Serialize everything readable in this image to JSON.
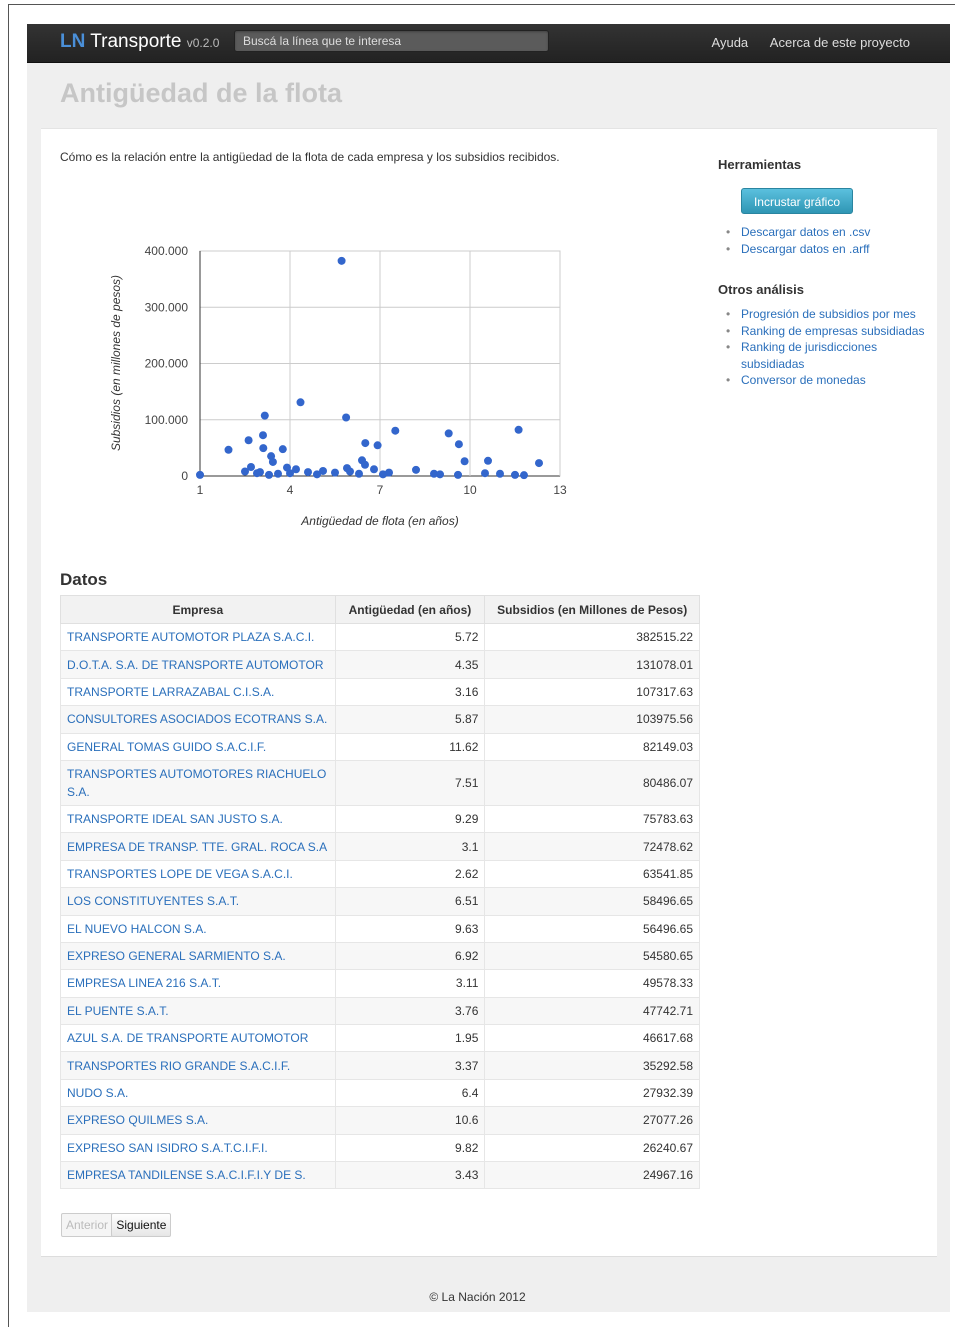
{
  "navbar": {
    "brand_ln": "LN",
    "brand_name": "Transporte",
    "version": "v0.2.0",
    "search_placeholder": "Buscá la línea que te interesa",
    "links": [
      "Ayuda",
      "Acerca de este proyecto"
    ]
  },
  "page": {
    "title": "Antigüedad de la flota",
    "intro": "Cómo es la relación entre la antigüedad de la flota de cada empresa y los subsidios recibidos."
  },
  "sidebar": {
    "tools_title": "Herramientas",
    "embed_button": "Incrustar gráfico",
    "downloads": [
      "Descargar datos en .csv",
      "Descargar datos en .arff"
    ],
    "other_title": "Otros análisis",
    "other_links": [
      "Progresión de subsidios por mes",
      "Ranking de empresas subsidiadas",
      "Ranking de jurisdicciones subsidiadas",
      "Conversor de monedas"
    ]
  },
  "chart_data": {
    "type": "scatter",
    "xlabel": "Antigüedad de flota (en años)",
    "ylabel": "Subsidios (en millones de pesos)",
    "xlim": [
      1,
      13
    ],
    "ylim": [
      0,
      400000
    ],
    "x_ticks": [
      "1",
      "4",
      "7",
      "10",
      "13"
    ],
    "y_ticks": [
      "0",
      "100.000",
      "200.000",
      "300.000",
      "400.000"
    ],
    "grid": true,
    "color": "#3366cc",
    "points": [
      [
        5.72,
        382515
      ],
      [
        4.35,
        131078
      ],
      [
        3.16,
        107318
      ],
      [
        5.87,
        103976
      ],
      [
        11.62,
        82149
      ],
      [
        7.51,
        80486
      ],
      [
        9.29,
        75784
      ],
      [
        3.1,
        72479
      ],
      [
        2.62,
        63542
      ],
      [
        6.51,
        58497
      ],
      [
        9.63,
        56497
      ],
      [
        6.92,
        54581
      ],
      [
        3.11,
        49578
      ],
      [
        3.76,
        47743
      ],
      [
        1.95,
        46618
      ],
      [
        3.37,
        35293
      ],
      [
        6.4,
        27932
      ],
      [
        10.6,
        27077
      ],
      [
        9.82,
        26241
      ],
      [
        3.43,
        24967
      ],
      [
        12.3,
        23000
      ],
      [
        6.5,
        20000
      ],
      [
        2.7,
        16000
      ],
      [
        3.9,
        15000
      ],
      [
        5.9,
        14000
      ],
      [
        4.2,
        12000
      ],
      [
        6.8,
        12000
      ],
      [
        8.2,
        11000
      ],
      [
        5.1,
        9000
      ],
      [
        2.5,
        8000
      ],
      [
        3.0,
        7000
      ],
      [
        4.6,
        7000
      ],
      [
        6.0,
        8000
      ],
      [
        7.3,
        6000
      ],
      [
        4.0,
        5000
      ],
      [
        2.9,
        5000
      ],
      [
        3.6,
        4000
      ],
      [
        5.5,
        6000
      ],
      [
        8.8,
        4000
      ],
      [
        10.5,
        5000
      ],
      [
        7.1,
        3000
      ],
      [
        9.0,
        3000
      ],
      [
        11.0,
        4000
      ],
      [
        11.5,
        2000
      ],
      [
        1.0,
        2000
      ],
      [
        4.9,
        3000
      ],
      [
        6.3,
        4000
      ],
      [
        9.6,
        2000
      ],
      [
        3.3,
        2000
      ],
      [
        11.8,
        1500
      ]
    ]
  },
  "datos": {
    "title": "Datos",
    "headers": [
      "Empresa",
      "Antigüedad (en años)",
      "Subsidios (en Millones de Pesos)"
    ],
    "rows": [
      [
        "TRANSPORTE AUTOMOTOR PLAZA S.A.C.I.",
        "5.72",
        "382515.22"
      ],
      [
        "D.O.T.A. S.A. DE TRANSPORTE AUTOMOTOR",
        "4.35",
        "131078.01"
      ],
      [
        "TRANSPORTE LARRAZABAL C.I.S.A.",
        "3.16",
        "107317.63"
      ],
      [
        "CONSULTORES ASOCIADOS ECOTRANS S.A.",
        "5.87",
        "103975.56"
      ],
      [
        "GENERAL TOMAS GUIDO S.A.C.I.F.",
        "11.62",
        "82149.03"
      ],
      [
        "TRANSPORTES AUTOMOTORES RIACHUELO S.A.",
        "7.51",
        "80486.07"
      ],
      [
        "TRANSPORTE IDEAL SAN JUSTO S.A.",
        "9.29",
        "75783.63"
      ],
      [
        "EMPRESA DE TRANSP. TTE. GRAL. ROCA S.A",
        "3.1",
        "72478.62"
      ],
      [
        "TRANSPORTES LOPE DE VEGA S.A.C.I.",
        "2.62",
        "63541.85"
      ],
      [
        "LOS CONSTITUYENTES S.A.T.",
        "6.51",
        "58496.65"
      ],
      [
        "EL NUEVO HALCON S.A.",
        "9.63",
        "56496.65"
      ],
      [
        "EXPRESO GENERAL SARMIENTO S.A.",
        "6.92",
        "54580.65"
      ],
      [
        "EMPRESA LINEA 216 S.A.T.",
        "3.11",
        "49578.33"
      ],
      [
        "EL PUENTE S.A.T.",
        "3.76",
        "47742.71"
      ],
      [
        "AZUL S.A. DE TRANSPORTE AUTOMOTOR",
        "1.95",
        "46617.68"
      ],
      [
        "TRANSPORTES RIO GRANDE S.A.C.I.F.",
        "3.37",
        "35292.58"
      ],
      [
        "NUDO S.A.",
        "6.4",
        "27932.39"
      ],
      [
        "EXPRESO QUILMES S.A.",
        "10.6",
        "27077.26"
      ],
      [
        "EXPRESO SAN ISIDRO S.A.T.C.I.F.I.",
        "9.82",
        "26240.67"
      ],
      [
        "EMPRESA TANDILENSE S.A.C.I.F.I.Y DE S.",
        "3.43",
        "24967.16"
      ]
    ],
    "prev": "Anterior",
    "next": "Siguiente"
  },
  "footer": "© La Nación 2012"
}
